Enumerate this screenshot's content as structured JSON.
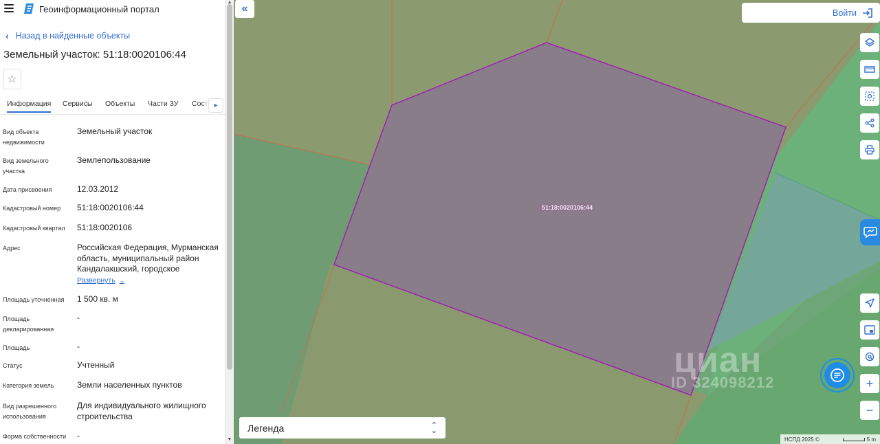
{
  "app": {
    "title": "Геоинформационный портал"
  },
  "nav": {
    "back_label": "Назад в найденные объекты"
  },
  "object": {
    "title": "Земельный участок: 51:18:0020106:44"
  },
  "tabs": [
    {
      "label": "Информация",
      "active": true
    },
    {
      "label": "Сервисы",
      "active": false
    },
    {
      "label": "Объекты",
      "active": false
    },
    {
      "label": "Части ЗУ",
      "active": false
    },
    {
      "label": "Соста",
      "active": false
    }
  ],
  "info": {
    "rows": [
      {
        "label": "Вид объекта недвижимости",
        "value": "Земельный участок"
      },
      {
        "label": "Вид земельного участка",
        "value": "Землепользование"
      },
      {
        "label": "Дата присвоения",
        "value": "12.03.2012"
      },
      {
        "label": "Кадастровый номер",
        "value": "51:18:0020106:44"
      },
      {
        "label": "Кадастровый квартал",
        "value": "51:18:0020106"
      },
      {
        "label": "Адрес",
        "value": "Российская Федерация, Мурманская область, муниципальный район Кандалакшский, городское"
      },
      {
        "label": "Площадь уточненная",
        "value": "1 500 кв. м"
      },
      {
        "label": "Площадь декларированная",
        "value": "-"
      },
      {
        "label": "Площадь",
        "value": "-"
      },
      {
        "label": "Статус",
        "value": "Учтенный"
      },
      {
        "label": "Категория земель",
        "value": "Земли населенных пунктов"
      },
      {
        "label": "Вид разрешенного использования",
        "value": "Для индивидуального жилищного строительства"
      },
      {
        "label": "Форма собственности",
        "value": "-"
      }
    ],
    "expand_label": "Развернуть"
  },
  "map": {
    "parcel_label": "51:18:0020106:44",
    "login_label": "Войти",
    "legend_label": "Легенда",
    "watermark_brand": "циан",
    "watermark_id": "ID 324098212",
    "attribution": "НСПД 2025 ©",
    "scale_label": "5 m",
    "zoom_in": "+",
    "zoom_out": "−"
  },
  "colors": {
    "accent": "#2f6fd0",
    "parcel_border": "#a020b0",
    "parcel_fill": "#8a7d8a",
    "chat": "#1f8de8"
  }
}
